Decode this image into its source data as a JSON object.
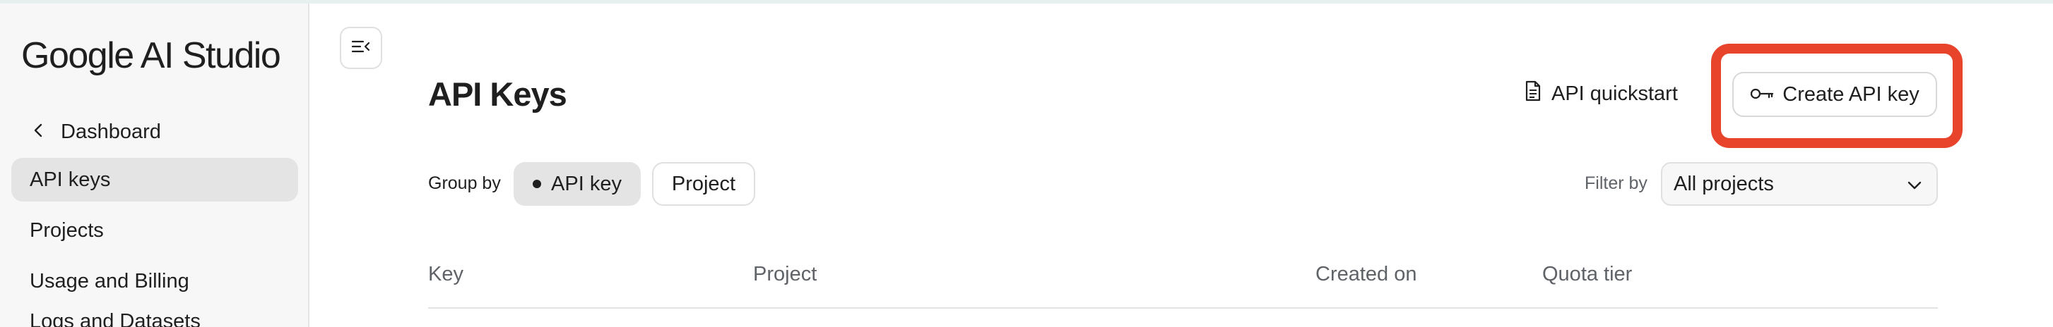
{
  "app": {
    "brand": "Google AI Studio"
  },
  "sidebar": {
    "back_label": "Dashboard",
    "items": [
      {
        "label": "API keys",
        "active": true
      },
      {
        "label": "Projects",
        "active": false
      },
      {
        "label": "Usage and Billing",
        "active": false
      },
      {
        "label": "Logs and Datasets",
        "active": false
      }
    ]
  },
  "header": {
    "title": "API Keys",
    "quickstart_label": "API quickstart",
    "create_label": "Create API key",
    "highlight_color": "#e8432b"
  },
  "toolbar": {
    "group_by_label": "Group by",
    "group_options": [
      "API key",
      "Project"
    ],
    "group_selected": "API key",
    "filter_label": "Filter by",
    "filter_value": "All projects"
  },
  "table": {
    "columns": [
      "Key",
      "Project",
      "Created on",
      "Quota tier"
    ]
  },
  "icons": {
    "collapse": "collapse-sidebar-icon",
    "back": "chevron-left-icon",
    "doc": "document-icon",
    "key": "key-icon",
    "dropdown": "chevron-down-icon"
  }
}
